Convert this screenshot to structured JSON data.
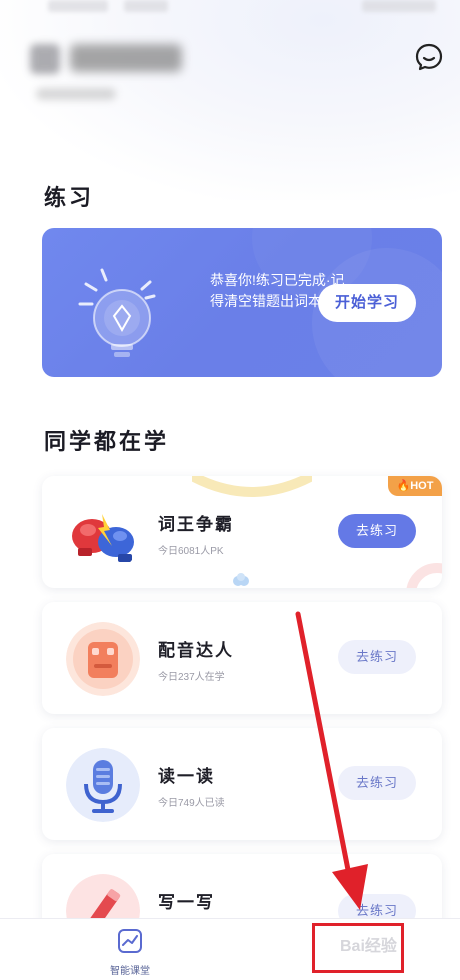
{
  "header": {
    "message_icon": "chat-bubble-smile-icon"
  },
  "practice": {
    "section_title": "练习",
    "banner": {
      "text": "恭喜你!练习已完成·记得清空错题出词本哦·",
      "button_label": "开始学习",
      "icon": "lightbulb-icon"
    }
  },
  "popular": {
    "section_title": "同学都在学",
    "cards": [
      {
        "title": "词王争霸",
        "subtitle": "今日6081人PK",
        "button_label": "去练习",
        "icon": "boxing-gloves-icon",
        "badge": "HOT",
        "style": "primary"
      },
      {
        "title": "配音达人",
        "subtitle": "今日237人在学",
        "button_label": "去练习",
        "icon": "robot-icon",
        "style": "soft"
      },
      {
        "title": "读一读",
        "subtitle": "今日749人已读",
        "button_label": "去练习",
        "icon": "microphone-icon",
        "style": "soft"
      },
      {
        "title": "写一写",
        "subtitle": "",
        "button_label": "去练习",
        "icon": "pencil-icon",
        "style": "soft"
      }
    ]
  },
  "tabbar": {
    "items": [
      {
        "label": "智能课堂",
        "icon": "chart-trend-icon"
      }
    ]
  },
  "watermark": "Bai经验",
  "colors": {
    "accent": "#6479e6",
    "banner": "#6d83ea",
    "hot": "#f3a148",
    "annotation": "#e0212a"
  }
}
